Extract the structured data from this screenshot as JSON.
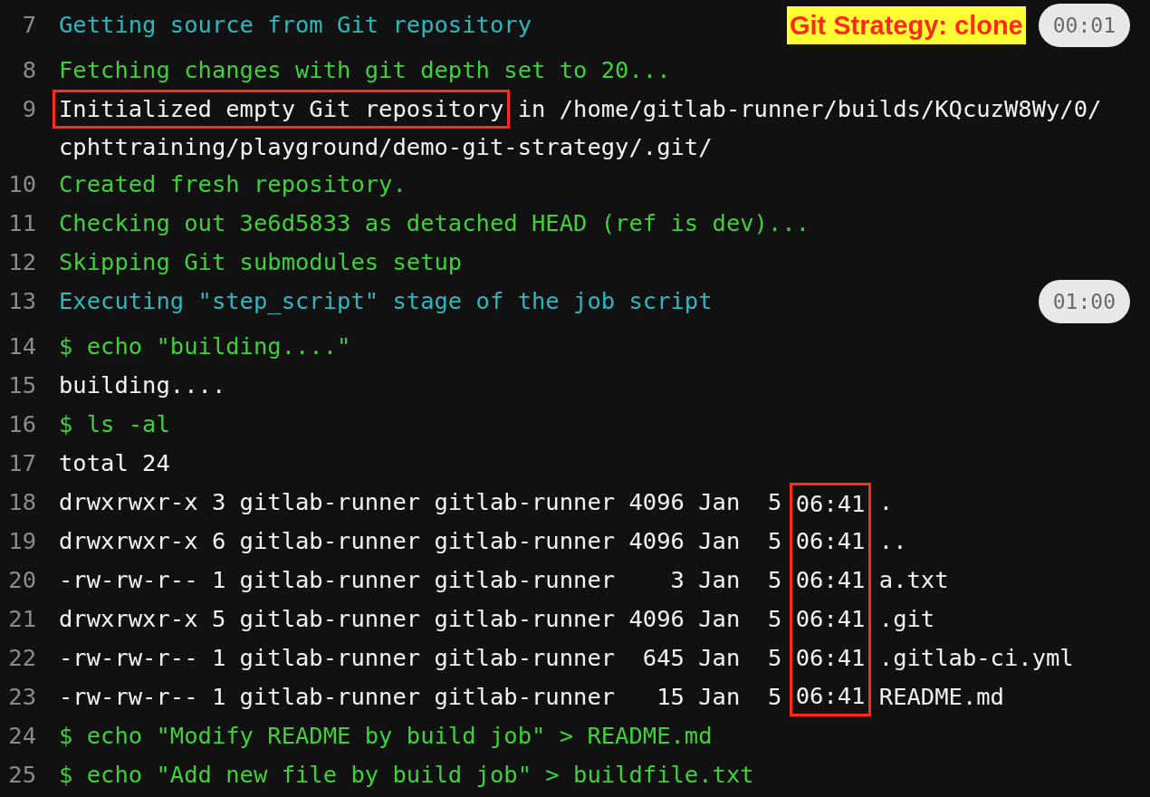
{
  "lines": [
    {
      "number": "7",
      "kind": "section",
      "segments": [
        {
          "text": "Getting source from Git repository",
          "boxed": false
        }
      ],
      "badge": "Git Strategy: clone",
      "duration": "00:01"
    },
    {
      "number": "8",
      "kind": "info",
      "segments": [
        {
          "text": "Fetching changes with git depth set to 20...",
          "boxed": false
        }
      ]
    },
    {
      "number": "9",
      "kind": "output",
      "segments": [
        {
          "text": "Initialized empty Git repository",
          "boxed": true
        },
        {
          "text": " in /home/gitlab-runner/builds/KQcuzW8Wy/0/",
          "boxed": false
        }
      ],
      "continuation": "cphttraining/playground/demo-git-strategy/.git/"
    },
    {
      "number": "10",
      "kind": "info",
      "segments": [
        {
          "text": "Created fresh repository.",
          "boxed": false
        }
      ]
    },
    {
      "number": "11",
      "kind": "info",
      "segments": [
        {
          "text": "Checking out 3e6d5833 as detached HEAD (ref is dev)...",
          "boxed": false
        }
      ]
    },
    {
      "number": "12",
      "kind": "info",
      "segments": [
        {
          "text": "Skipping Git submodules setup",
          "boxed": false
        }
      ]
    },
    {
      "number": "13",
      "kind": "section",
      "segments": [
        {
          "text": "Executing \"step_script\" stage of the job script",
          "boxed": false
        }
      ],
      "duration": "01:00"
    },
    {
      "number": "14",
      "kind": "info",
      "segments": [
        {
          "text": "$ echo \"building....\"",
          "boxed": false
        }
      ]
    },
    {
      "number": "15",
      "kind": "output",
      "segments": [
        {
          "text": "building....",
          "boxed": false
        }
      ]
    },
    {
      "number": "16",
      "kind": "info",
      "segments": [
        {
          "text": "$ ls -al",
          "boxed": false
        }
      ]
    },
    {
      "number": "17",
      "kind": "output",
      "segments": [
        {
          "text": "total 24",
          "boxed": false
        }
      ]
    },
    {
      "number": "18",
      "kind": "output",
      "segments": [
        {
          "text": "drwxrwxr-x 3 gitlab-runner gitlab-runner 4096 Jan  5 ",
          "boxed": false
        },
        {
          "text": "06:41",
          "boxed": true
        },
        {
          "text": " .",
          "boxed": false
        }
      ]
    },
    {
      "number": "19",
      "kind": "output",
      "segments": [
        {
          "text": "drwxrwxr-x 6 gitlab-runner gitlab-runner 4096 Jan  5 ",
          "boxed": false
        },
        {
          "text": "06:41",
          "boxed": true
        },
        {
          "text": " ..",
          "boxed": false
        }
      ]
    },
    {
      "number": "20",
      "kind": "output",
      "segments": [
        {
          "text": "-rw-rw-r-- 1 gitlab-runner gitlab-runner    3 Jan  5 ",
          "boxed": false
        },
        {
          "text": "06:41",
          "boxed": true
        },
        {
          "text": " a.txt",
          "boxed": false
        }
      ]
    },
    {
      "number": "21",
      "kind": "output",
      "segments": [
        {
          "text": "drwxrwxr-x 5 gitlab-runner gitlab-runner 4096 Jan  5 ",
          "boxed": false
        },
        {
          "text": "06:41",
          "boxed": true
        },
        {
          "text": " .git",
          "boxed": false
        }
      ]
    },
    {
      "number": "22",
      "kind": "output",
      "segments": [
        {
          "text": "-rw-rw-r-- 1 gitlab-runner gitlab-runner  645 Jan  5 ",
          "boxed": false
        },
        {
          "text": "06:41",
          "boxed": true
        },
        {
          "text": " .gitlab-ci.yml",
          "boxed": false
        }
      ]
    },
    {
      "number": "23",
      "kind": "output",
      "segments": [
        {
          "text": "-rw-rw-r-- 1 gitlab-runner gitlab-runner   15 Jan  5 ",
          "boxed": false
        },
        {
          "text": "06:41",
          "boxed": true
        },
        {
          "text": " README.md",
          "boxed": false
        }
      ]
    },
    {
      "number": "24",
      "kind": "info",
      "segments": [
        {
          "text": "$ echo \"Modify README by build job\" > README.md",
          "boxed": false
        }
      ]
    },
    {
      "number": "25",
      "kind": "info",
      "segments": [
        {
          "text": "$ echo \"Add new file by build job\" > buildfile.txt",
          "boxed": false
        }
      ]
    }
  ]
}
